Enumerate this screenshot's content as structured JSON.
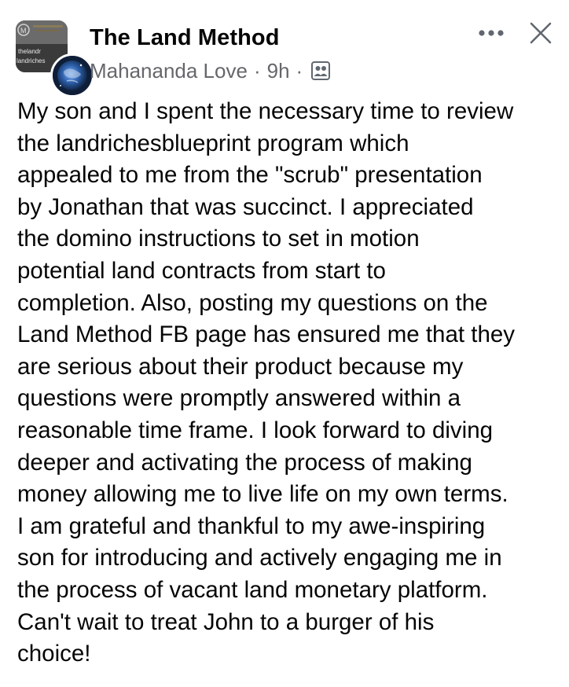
{
  "post": {
    "group_name": "The Land Method",
    "author": "Mahananda Love",
    "separator": "·",
    "time": "9h",
    "group_avatar_text": [
      "thelandr",
      "landriches"
    ],
    "body_lines": [
      "My son and I spent the necessary time to review",
      "the landrichesblueprint program which",
      "appealed to me from the \"scrub\" presentation",
      "by Jonathan that was succinct. I appreciated",
      "the domino instructions to set in motion",
      "potential land contracts from start to",
      "completion. Also, posting my questions on the",
      "Land Method FB page has ensured me that they",
      "are serious about their product because my",
      "questions were promptly answered within a",
      "reasonable time frame. I look forward to diving",
      "deeper and activating the process of making",
      "money allowing me to live life on my own terms.",
      "I am grateful and thankful to my awe-inspiring",
      "son for introducing and actively engaging me in",
      "the process of vacant land monetary platform.",
      "Can't wait to treat John to a burger of his",
      "choice!"
    ]
  },
  "icons": {
    "more": "more-horizontal-icon",
    "close": "close-icon",
    "audience": "group-members-icon"
  },
  "colors": {
    "text_primary": "#050505",
    "text_secondary": "#65676b",
    "icon": "#606770"
  }
}
